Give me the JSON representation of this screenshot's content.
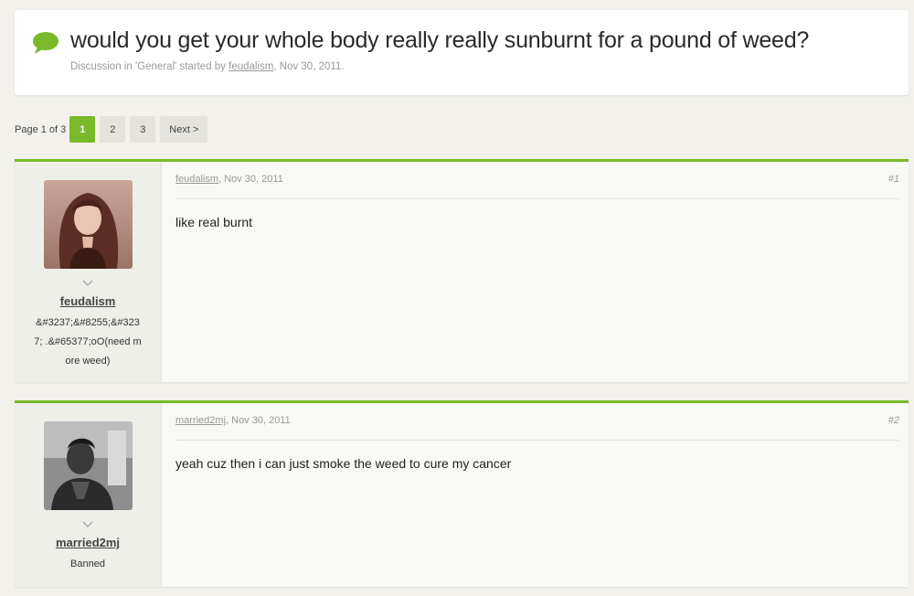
{
  "thread": {
    "title": "would you get your whole body really really sunburnt for a pound of weed?",
    "meta_prefix": "Discussion in 'General' started by",
    "meta_author": "feudalism",
    "meta_date": ", Nov 30, 2011."
  },
  "pagination": {
    "label": "Page 1 of 3",
    "pages": [
      "1",
      "2",
      "3"
    ],
    "active_page": "1",
    "next_label": "Next >"
  },
  "posts": [
    {
      "author": "feudalism",
      "date": ", Nov 30, 2011",
      "number": "#1",
      "user_title": "&#3237;&#8255;&#3237; .&#65377;oO(need more weed)",
      "body": "like real burnt"
    },
    {
      "author": "married2mj",
      "date": ", Nov 30, 2011",
      "number": "#2",
      "user_title": "Banned",
      "body": "yeah cuz then i can just smoke the weed to cure my cancer"
    }
  ],
  "colors": {
    "accent": "#7ab92a",
    "background": "#f2f1ec"
  },
  "icons": {
    "thread": "speech-bubble-icon",
    "user_menu": "chevron-down-icon"
  }
}
